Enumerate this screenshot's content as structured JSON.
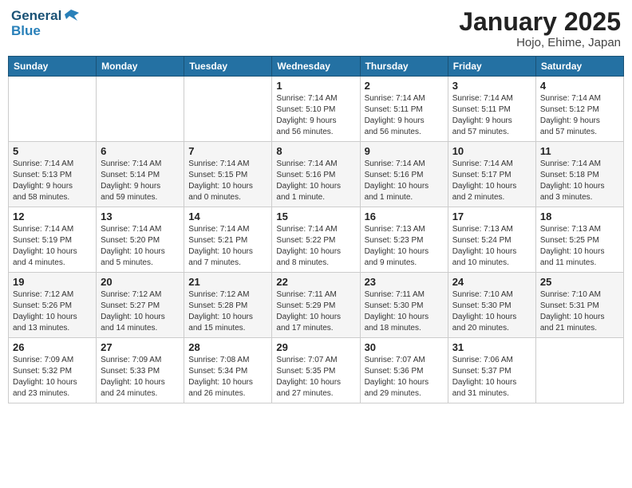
{
  "logo": {
    "line1": "General",
    "line2": "Blue"
  },
  "calendar": {
    "title": "January 2025",
    "subtitle": "Hojo, Ehime, Japan",
    "headers": [
      "Sunday",
      "Monday",
      "Tuesday",
      "Wednesday",
      "Thursday",
      "Friday",
      "Saturday"
    ],
    "weeks": [
      [
        {
          "day": null,
          "info": null
        },
        {
          "day": null,
          "info": null
        },
        {
          "day": null,
          "info": null
        },
        {
          "day": "1",
          "info": "Sunrise: 7:14 AM\nSunset: 5:10 PM\nDaylight: 9 hours\nand 56 minutes."
        },
        {
          "day": "2",
          "info": "Sunrise: 7:14 AM\nSunset: 5:11 PM\nDaylight: 9 hours\nand 56 minutes."
        },
        {
          "day": "3",
          "info": "Sunrise: 7:14 AM\nSunset: 5:11 PM\nDaylight: 9 hours\nand 57 minutes."
        },
        {
          "day": "4",
          "info": "Sunrise: 7:14 AM\nSunset: 5:12 PM\nDaylight: 9 hours\nand 57 minutes."
        }
      ],
      [
        {
          "day": "5",
          "info": "Sunrise: 7:14 AM\nSunset: 5:13 PM\nDaylight: 9 hours\nand 58 minutes."
        },
        {
          "day": "6",
          "info": "Sunrise: 7:14 AM\nSunset: 5:14 PM\nDaylight: 9 hours\nand 59 minutes."
        },
        {
          "day": "7",
          "info": "Sunrise: 7:14 AM\nSunset: 5:15 PM\nDaylight: 10 hours\nand 0 minutes."
        },
        {
          "day": "8",
          "info": "Sunrise: 7:14 AM\nSunset: 5:16 PM\nDaylight: 10 hours\nand 1 minute."
        },
        {
          "day": "9",
          "info": "Sunrise: 7:14 AM\nSunset: 5:16 PM\nDaylight: 10 hours\nand 1 minute."
        },
        {
          "day": "10",
          "info": "Sunrise: 7:14 AM\nSunset: 5:17 PM\nDaylight: 10 hours\nand 2 minutes."
        },
        {
          "day": "11",
          "info": "Sunrise: 7:14 AM\nSunset: 5:18 PM\nDaylight: 10 hours\nand 3 minutes."
        }
      ],
      [
        {
          "day": "12",
          "info": "Sunrise: 7:14 AM\nSunset: 5:19 PM\nDaylight: 10 hours\nand 4 minutes."
        },
        {
          "day": "13",
          "info": "Sunrise: 7:14 AM\nSunset: 5:20 PM\nDaylight: 10 hours\nand 5 minutes."
        },
        {
          "day": "14",
          "info": "Sunrise: 7:14 AM\nSunset: 5:21 PM\nDaylight: 10 hours\nand 7 minutes."
        },
        {
          "day": "15",
          "info": "Sunrise: 7:14 AM\nSunset: 5:22 PM\nDaylight: 10 hours\nand 8 minutes."
        },
        {
          "day": "16",
          "info": "Sunrise: 7:13 AM\nSunset: 5:23 PM\nDaylight: 10 hours\nand 9 minutes."
        },
        {
          "day": "17",
          "info": "Sunrise: 7:13 AM\nSunset: 5:24 PM\nDaylight: 10 hours\nand 10 minutes."
        },
        {
          "day": "18",
          "info": "Sunrise: 7:13 AM\nSunset: 5:25 PM\nDaylight: 10 hours\nand 11 minutes."
        }
      ],
      [
        {
          "day": "19",
          "info": "Sunrise: 7:12 AM\nSunset: 5:26 PM\nDaylight: 10 hours\nand 13 minutes."
        },
        {
          "day": "20",
          "info": "Sunrise: 7:12 AM\nSunset: 5:27 PM\nDaylight: 10 hours\nand 14 minutes."
        },
        {
          "day": "21",
          "info": "Sunrise: 7:12 AM\nSunset: 5:28 PM\nDaylight: 10 hours\nand 15 minutes."
        },
        {
          "day": "22",
          "info": "Sunrise: 7:11 AM\nSunset: 5:29 PM\nDaylight: 10 hours\nand 17 minutes."
        },
        {
          "day": "23",
          "info": "Sunrise: 7:11 AM\nSunset: 5:30 PM\nDaylight: 10 hours\nand 18 minutes."
        },
        {
          "day": "24",
          "info": "Sunrise: 7:10 AM\nSunset: 5:30 PM\nDaylight: 10 hours\nand 20 minutes."
        },
        {
          "day": "25",
          "info": "Sunrise: 7:10 AM\nSunset: 5:31 PM\nDaylight: 10 hours\nand 21 minutes."
        }
      ],
      [
        {
          "day": "26",
          "info": "Sunrise: 7:09 AM\nSunset: 5:32 PM\nDaylight: 10 hours\nand 23 minutes."
        },
        {
          "day": "27",
          "info": "Sunrise: 7:09 AM\nSunset: 5:33 PM\nDaylight: 10 hours\nand 24 minutes."
        },
        {
          "day": "28",
          "info": "Sunrise: 7:08 AM\nSunset: 5:34 PM\nDaylight: 10 hours\nand 26 minutes."
        },
        {
          "day": "29",
          "info": "Sunrise: 7:07 AM\nSunset: 5:35 PM\nDaylight: 10 hours\nand 27 minutes."
        },
        {
          "day": "30",
          "info": "Sunrise: 7:07 AM\nSunset: 5:36 PM\nDaylight: 10 hours\nand 29 minutes."
        },
        {
          "day": "31",
          "info": "Sunrise: 7:06 AM\nSunset: 5:37 PM\nDaylight: 10 hours\nand 31 minutes."
        },
        {
          "day": null,
          "info": null
        }
      ]
    ]
  }
}
